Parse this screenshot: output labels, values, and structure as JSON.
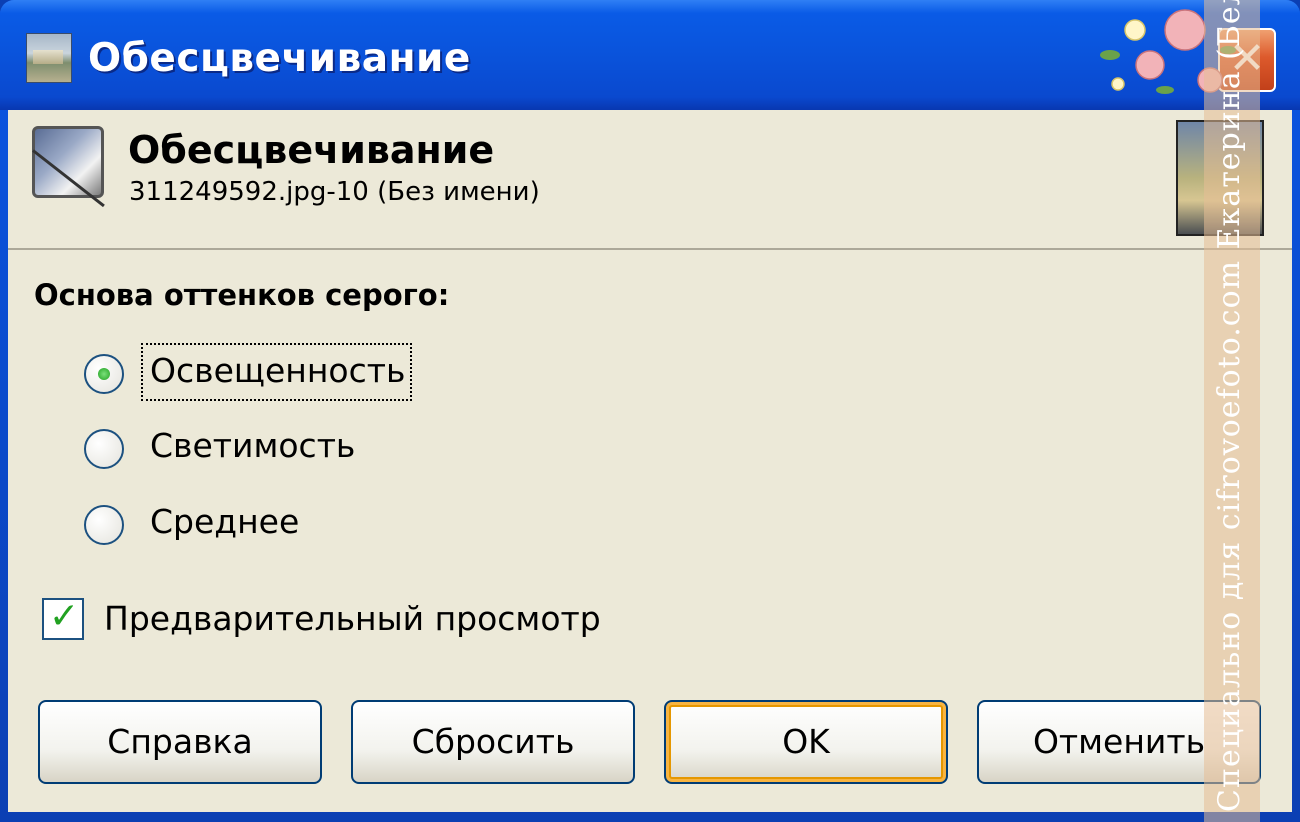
{
  "window": {
    "title": "Обесцвечивание",
    "close_symbol": "✕"
  },
  "header": {
    "title": "Обесцвечивание",
    "subtitle": "311249592.jpg-10 (Без имени)"
  },
  "section": {
    "label": "Основа оттенков серого:"
  },
  "options": [
    {
      "label": "Освещенность",
      "selected": true
    },
    {
      "label": "Светимость",
      "selected": false
    },
    {
      "label": "Среднее",
      "selected": false
    }
  ],
  "preview": {
    "label": "Предварительный просмотр",
    "checked": true,
    "check_symbol": "✓"
  },
  "buttons": {
    "help": "Справка",
    "reset": "Сбросить",
    "ok": "OK",
    "cancel": "Отменить"
  },
  "watermark": {
    "text": "Специально для cifrovoefoto.com Екатерина (Белая_Кап)"
  },
  "colors": {
    "titlebar": "#0a53db",
    "client_bg": "#ece9d8",
    "accent_green": "#21a121",
    "default_button_glow": "#f8b441"
  },
  "icons": {
    "title": "desaturate-icon",
    "header": "desaturate-tool-icon",
    "close": "close-icon"
  }
}
